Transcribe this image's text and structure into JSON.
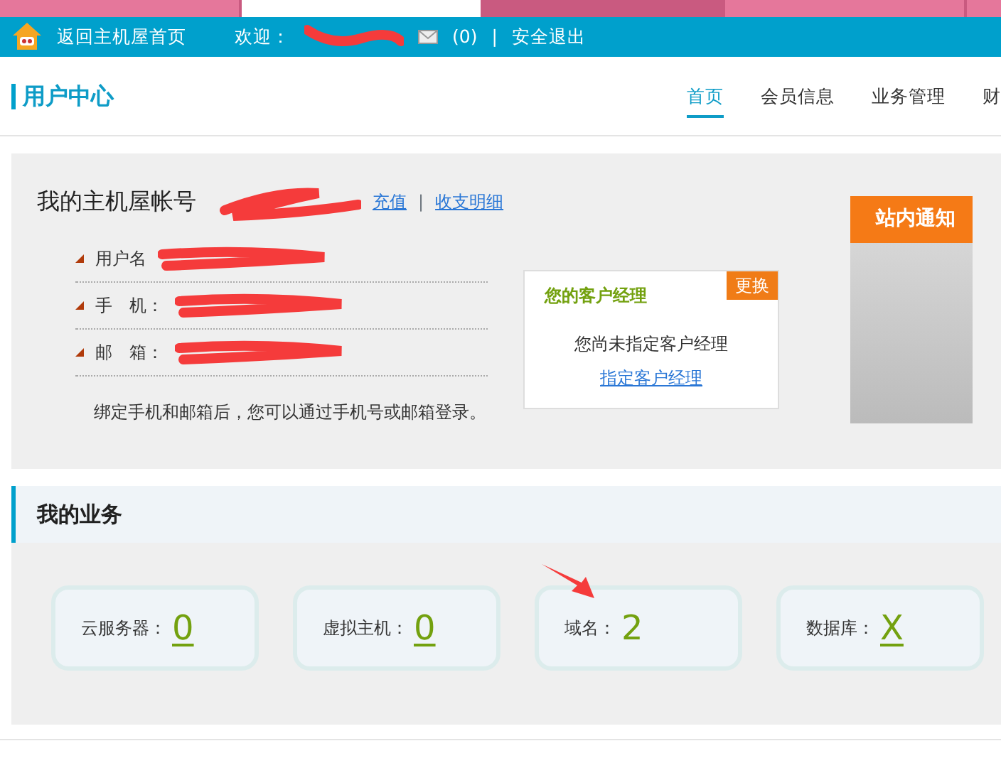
{
  "browser_tabs": [
    {
      "selected": false
    },
    {
      "selected": true
    },
    {
      "selected": false
    },
    {
      "selected": false
    }
  ],
  "top_bar": {
    "home_link": "返回主机屋首页",
    "welcome": "欢迎：",
    "message_count": "(0)",
    "separator": "|",
    "logout": "安全退出"
  },
  "header": {
    "title": "用户中心",
    "nav": [
      {
        "label": "首页",
        "selected": true
      },
      {
        "label": "会员信息",
        "selected": false
      },
      {
        "label": "业务管理",
        "selected": false
      },
      {
        "label": "财",
        "selected": false
      }
    ]
  },
  "account": {
    "title": "我的主机屋帐号",
    "recharge": "充值",
    "details": "收支明细",
    "fields": [
      "用户名",
      "手　机：",
      "邮　箱："
    ],
    "note": "绑定手机和邮箱后，您可以通过手机号或邮箱登录。"
  },
  "manager": {
    "title": "您的客户经理",
    "change": "更换",
    "status": "您尚未指定客户经理",
    "assign": "指定客户经理"
  },
  "notice": {
    "title": "站内通知"
  },
  "business": {
    "title": "我的业务",
    "items": [
      {
        "label": "云服务器：",
        "value": "0"
      },
      {
        "label": "虚拟主机：",
        "value": "0"
      },
      {
        "label": "域名：",
        "value": "2"
      },
      {
        "label": "数据库：",
        "value": "X"
      }
    ]
  }
}
